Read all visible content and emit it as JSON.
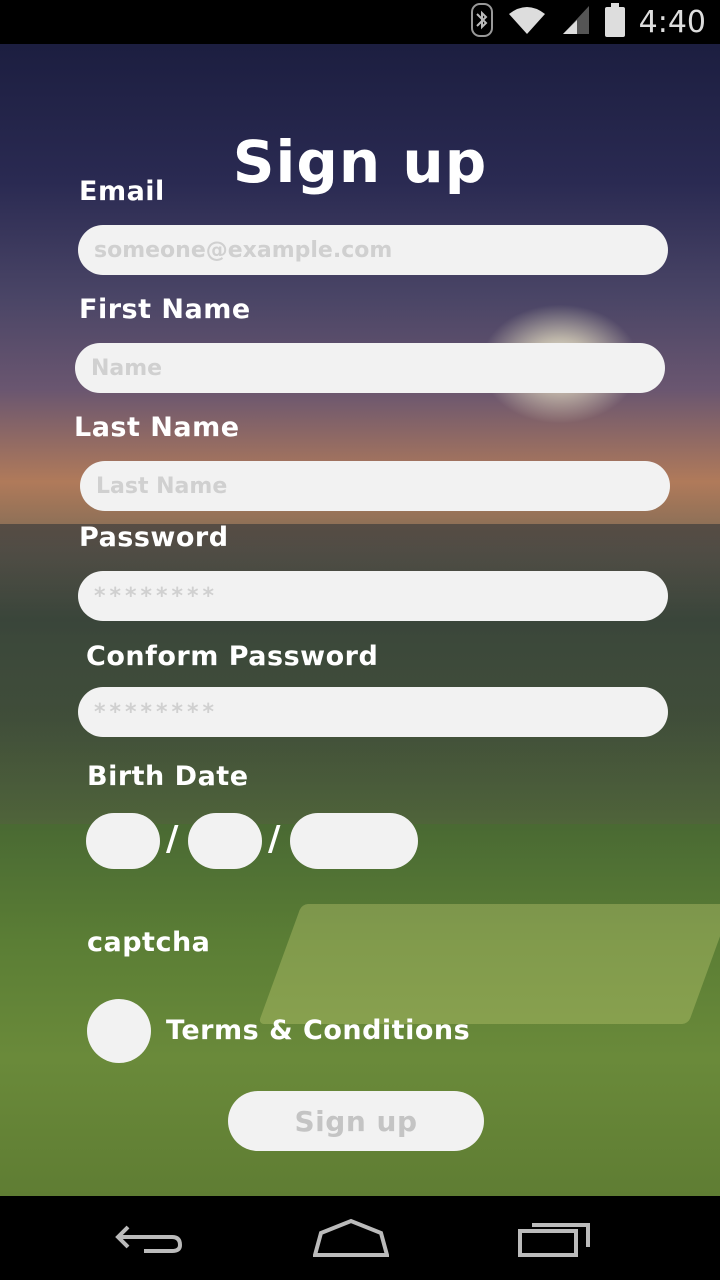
{
  "status_bar": {
    "time": "4:40",
    "icons": [
      "bluetooth-icon",
      "wifi-icon",
      "signal-icon",
      "battery-icon"
    ]
  },
  "form": {
    "title": "Sign up",
    "email": {
      "label": "Email",
      "placeholder": "someone@example.com",
      "value": ""
    },
    "first_name": {
      "label": "First Name",
      "placeholder": "Name",
      "value": ""
    },
    "last_name": {
      "label": "Last Name",
      "placeholder": "Last Name",
      "value": ""
    },
    "password": {
      "label": "Password",
      "placeholder": "********",
      "value": ""
    },
    "confirm_password": {
      "label": "Conform Password",
      "placeholder": "********",
      "value": ""
    },
    "birth_date": {
      "label": "Birth Date",
      "separator": "/"
    },
    "captcha": {
      "label": "captcha"
    },
    "terms": {
      "label": "Terms & Conditions",
      "checked": false
    },
    "submit_label": "Sign up"
  },
  "nav_bar": {
    "icons": [
      "back-icon",
      "home-icon",
      "recent-apps-icon"
    ]
  },
  "colors": {
    "field_background": "#f2f2f2",
    "placeholder": "#d0d0d0",
    "text": "#ffffff"
  }
}
